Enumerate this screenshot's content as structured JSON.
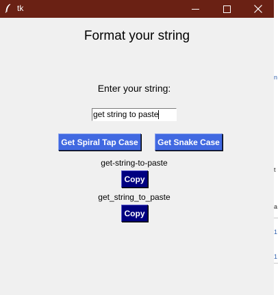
{
  "window": {
    "title": "tk",
    "title_bar_color": "#6a2114",
    "background": "#f0f0f0"
  },
  "icons": {
    "app": "feather-icon",
    "minimize": "minimize-icon",
    "maximize": "maximize-icon",
    "close": "close-icon"
  },
  "main": {
    "heading": "Format your string",
    "prompt": "Enter your string:",
    "input_value": "get string to paste",
    "buttons": {
      "spiral": "Get Spiral Tap Case",
      "snake": "Get Snake Case"
    },
    "results": [
      {
        "value": "get-string-to-paste",
        "copy_label": "Copy"
      },
      {
        "value": "get_string_to_paste",
        "copy_label": "Copy"
      }
    ]
  },
  "background_window": {
    "fragments": [
      "n",
      "t",
      "a",
      "1",
      "1"
    ]
  },
  "colors": {
    "action_button": "#4169e1",
    "copy_button": "#000080",
    "button_text": "#ffffff"
  }
}
